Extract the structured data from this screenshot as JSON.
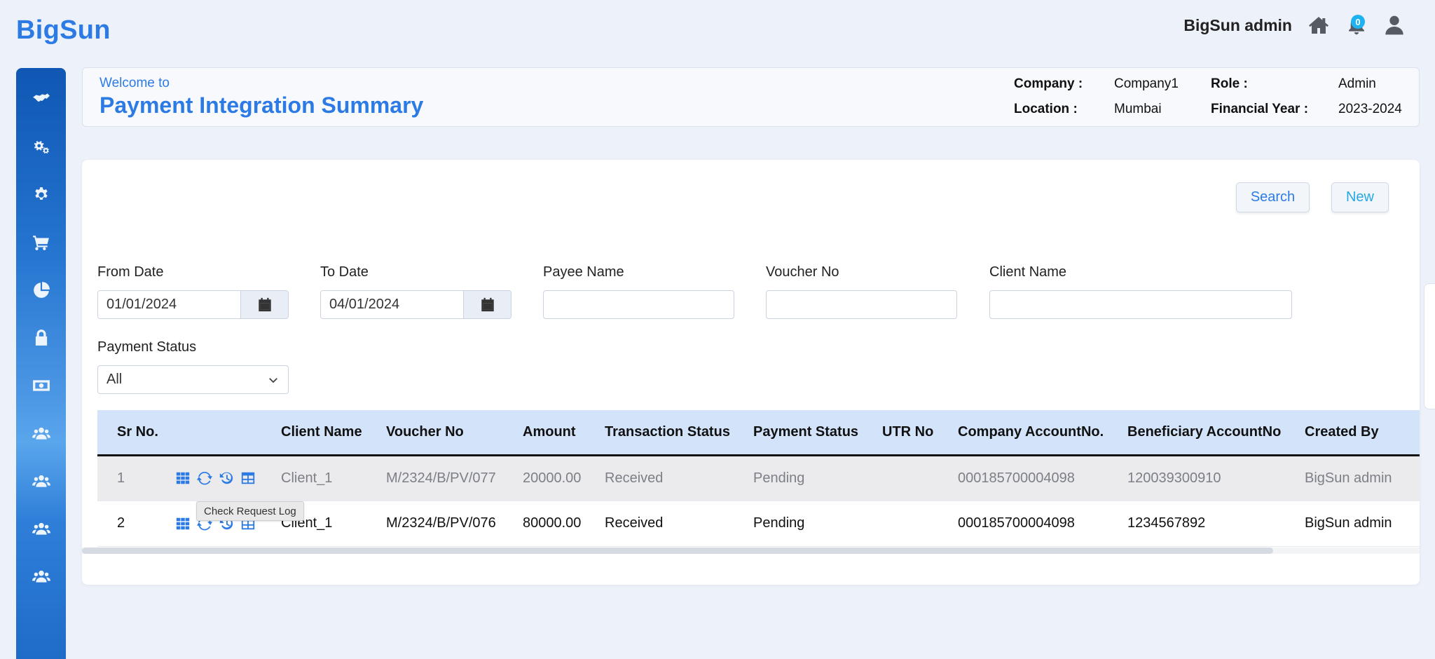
{
  "app": {
    "brand": "BigSun"
  },
  "topbar": {
    "user_name": "BigSun admin",
    "notification_count": "0",
    "icons": [
      "home-icon",
      "bell-icon",
      "user-icon"
    ]
  },
  "sidebar": {
    "items": [
      {
        "icon": "handshake-icon"
      },
      {
        "icon": "gears-icon"
      },
      {
        "icon": "gear-icon"
      },
      {
        "icon": "cart-icon"
      },
      {
        "icon": "pie-chart-icon"
      },
      {
        "icon": "lock-icon"
      },
      {
        "icon": "money-icon"
      },
      {
        "icon": "users-icon"
      },
      {
        "icon": "users-icon"
      },
      {
        "icon": "users-icon"
      },
      {
        "icon": "users-icon"
      }
    ]
  },
  "header": {
    "welcome": "Welcome to",
    "title": "Payment Integration Summary",
    "company_label": "Company :",
    "company_value": "Company1",
    "role_label": "Role :",
    "role_value": "Admin",
    "location_label": "Location :",
    "location_value": "Mumbai",
    "fy_label": "Financial Year :",
    "fy_value": "2023-2024"
  },
  "toolbar": {
    "search_label": "Search",
    "new_label": "New"
  },
  "filters": {
    "from_date_label": "From Date",
    "from_date_value": "01/01/2024",
    "to_date_label": "To Date",
    "to_date_value": "04/01/2024",
    "payee_label": "Payee Name",
    "payee_value": "",
    "voucher_label": "Voucher No",
    "voucher_value": "",
    "client_label": "Client Name",
    "client_value": "",
    "status_label": "Payment Status",
    "status_value": "All"
  },
  "table": {
    "columns": [
      "Sr No.",
      "",
      "Client Name",
      "Voucher No",
      "Amount",
      "Transaction Status",
      "Payment Status",
      "UTR No",
      "Company AccountNo.",
      "Beneficiary AccountNo",
      "Created By"
    ],
    "rows": [
      {
        "sr": "1",
        "client": "Client_1",
        "voucher": "M/2324/B/PV/077",
        "amount": "20000.00",
        "txn_status": "Received",
        "pay_status": "Pending",
        "utr": "",
        "company_acc": "000185700004098",
        "beneficiary_acc": "120039300910",
        "created_by": "BigSun admin"
      },
      {
        "sr": "2",
        "client": "Client_1",
        "voucher": "M/2324/B/PV/076",
        "amount": "80000.00",
        "txn_status": "Received",
        "pay_status": "Pending",
        "utr": "",
        "company_acc": "000185700004098",
        "beneficiary_acc": "1234567892",
        "created_by": "BigSun admin"
      }
    ]
  },
  "tooltip": {
    "text": "Check Request Log"
  },
  "colors": {
    "accent": "#2c7be5",
    "new_button": "#27a8e6",
    "badge": "#1fb2f0",
    "header_row": "#d3e3fa"
  }
}
